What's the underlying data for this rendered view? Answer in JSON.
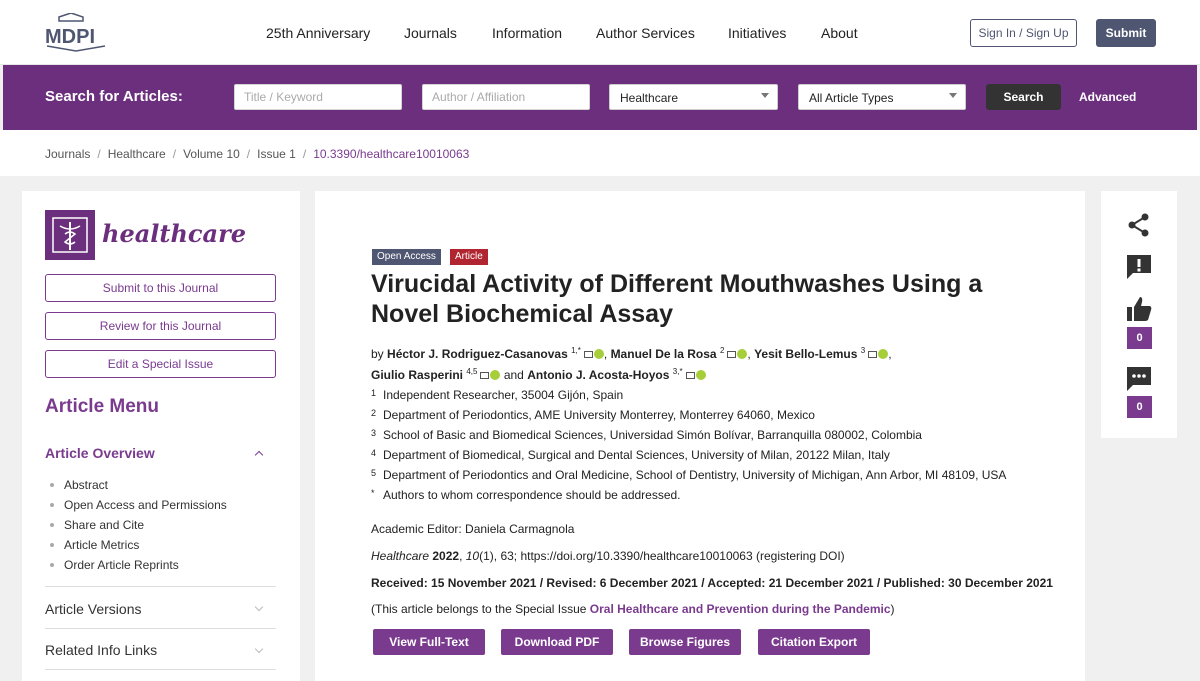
{
  "nav": {
    "logo_text": "MDPI",
    "items": [
      "25th Anniversary",
      "Journals",
      "Information",
      "Author Services",
      "Initiatives",
      "About"
    ],
    "signin_label": "Sign In / Sign Up",
    "submit_label": "Submit"
  },
  "search": {
    "label": "Search for Articles:",
    "title_placeholder": "Title / Keyword",
    "author_placeholder": "Author / Affiliation",
    "journal_select": "Healthcare",
    "type_select": "All Article Types",
    "search_button": "Search",
    "advanced_link": "Advanced"
  },
  "breadcrumb": {
    "items": [
      "Journals",
      "Healthcare",
      "Volume 10",
      "Issue 1"
    ],
    "current": "10.3390/healthcare10010063"
  },
  "sidebar": {
    "journal_name": "healthcare",
    "buttons": [
      "Submit to this Journal",
      "Review for this Journal",
      "Edit a Special Issue"
    ],
    "menu_title": "Article Menu",
    "overview_title": "Article Overview",
    "overview_items": [
      "Abstract",
      "Open Access and Permissions",
      "Share and Cite",
      "Article Metrics",
      "Order Article Reprints"
    ],
    "sections": [
      "Article Versions",
      "Related Info Links"
    ]
  },
  "article": {
    "badge_open_access": "Open Access",
    "badge_type": "Article",
    "title": "Virucidal Activity of Different Mouthwashes Using a Novel Biochemical Assay",
    "by": "by",
    "authors": [
      {
        "name": "Héctor J. Rodriguez-Casanovas",
        "sup": "1,*"
      },
      {
        "name": "Manuel De la Rosa",
        "sup": "2"
      },
      {
        "name": "Yesit Bello-Lemus",
        "sup": "3"
      },
      {
        "name": "Giulio Rasperini",
        "sup": "4,5"
      },
      {
        "name": "Antonio J. Acosta-Hoyos",
        "sup": "3,*"
      }
    ],
    "and": "and",
    "affiliations": [
      {
        "num": "1",
        "text": "Independent Researcher, 35004 Gijón, Spain"
      },
      {
        "num": "2",
        "text": "Department of Periodontics, AME University Monterrey, Monterrey 64060, Mexico"
      },
      {
        "num": "3",
        "text": "School of Basic and Biomedical Sciences, Universidad Simón Bolívar, Barranquilla 080002, Colombia"
      },
      {
        "num": "4",
        "text": "Department of Biomedical, Surgical and Dental Sciences, University of Milan, 20122 Milan, Italy"
      },
      {
        "num": "5",
        "text": "Department of Periodontics and Oral Medicine, School of Dentistry, University of Michigan, Ann Arbor, MI 48109, USA"
      },
      {
        "num": "*",
        "text": "Authors to whom correspondence should be addressed."
      }
    ],
    "academic_editor": "Academic Editor: Daniela Carmagnola",
    "citation_journal": "Healthcare",
    "citation_year": "2022",
    "citation_volume": "10",
    "citation_rest": "(1), 63; https://doi.org/10.3390/healthcare10010063 (registering DOI)",
    "dates": "Received: 15 November 2021 / Revised: 6 December 2021 / Accepted: 21 December 2021 / Published: 30 December 2021",
    "special_prefix": "(This article belongs to the Special Issue ",
    "special_issue": "Oral Healthcare and Prevention during the Pandemic",
    "special_suffix": ")",
    "actions": [
      "View Full-Text",
      "Download PDF",
      "Browse Figures",
      "Citation Export"
    ]
  },
  "rightpanel": {
    "icons": [
      "share-icon",
      "report-icon",
      "like-icon",
      "comment-icon"
    ],
    "like_count": "0",
    "comment_count": "0"
  },
  "colors": {
    "brand_purple": "#6c2f7e",
    "link_purple": "#7a3b8f",
    "nav_dark": "#4f5671",
    "article_red": "#b0252f"
  }
}
